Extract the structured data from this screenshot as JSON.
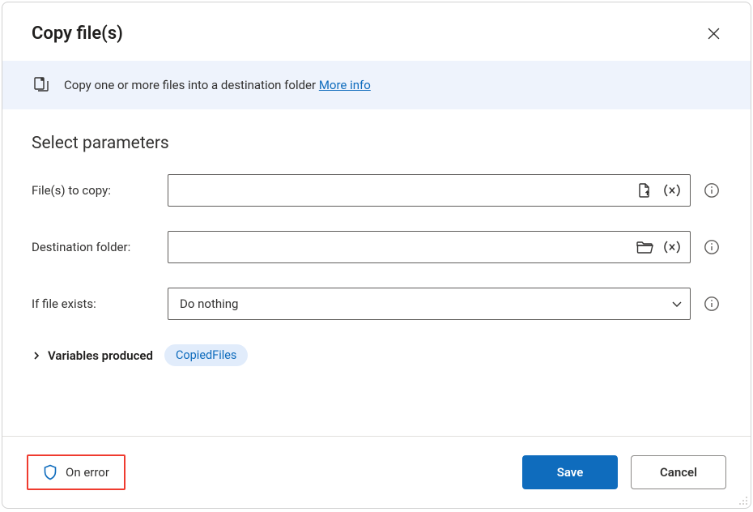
{
  "dialog": {
    "title": "Copy file(s)"
  },
  "info": {
    "text": "Copy one or more files into a destination folder",
    "link_label": "More info"
  },
  "section": {
    "heading": "Select parameters"
  },
  "params": {
    "files_to_copy": {
      "label": "File(s) to copy:",
      "value": ""
    },
    "destination": {
      "label": "Destination folder:",
      "value": ""
    },
    "if_exists": {
      "label": "If file exists:",
      "value": "Do nothing"
    }
  },
  "variables": {
    "header": "Variables produced",
    "items": [
      "CopiedFiles"
    ]
  },
  "footer": {
    "on_error": "On error",
    "save": "Save",
    "cancel": "Cancel"
  }
}
